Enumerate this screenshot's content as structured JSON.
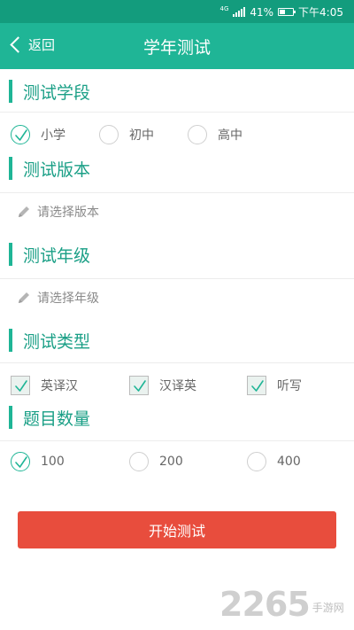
{
  "statusbar": {
    "network": "4G",
    "battery_percent": "41%",
    "battery_level": 0.41,
    "time": "下午4:05"
  },
  "header": {
    "back_label": "返回",
    "title": "学年测试"
  },
  "sections": {
    "stage": {
      "heading": "测试学段",
      "options": [
        {
          "label": "小学",
          "selected": true
        },
        {
          "label": "初中",
          "selected": false
        },
        {
          "label": "高中",
          "selected": false
        }
      ]
    },
    "edition": {
      "heading": "测试版本",
      "placeholder": "请选择版本"
    },
    "grade": {
      "heading": "测试年级",
      "placeholder": "请选择年级"
    },
    "type": {
      "heading": "测试类型",
      "options": [
        {
          "label": "英译汉",
          "checked": true
        },
        {
          "label": "汉译英",
          "checked": true
        },
        {
          "label": "听写",
          "checked": true
        }
      ]
    },
    "count": {
      "heading": "题目数量",
      "options": [
        {
          "label": "100",
          "selected": true
        },
        {
          "label": "200",
          "selected": false
        },
        {
          "label": "400",
          "selected": false
        }
      ]
    }
  },
  "start_button": "开始测试",
  "watermark": {
    "number": "2265",
    "text": "手游网"
  },
  "colors": {
    "header": "#1fb596",
    "statusbar": "#139c7d",
    "accent": "#1fb596",
    "button": "#e84d3d"
  },
  "icons": {
    "back": "chevron-left-icon",
    "pencil": "pencil-icon",
    "radio": "radio-icon",
    "checkbox": "checkbox-icon"
  }
}
